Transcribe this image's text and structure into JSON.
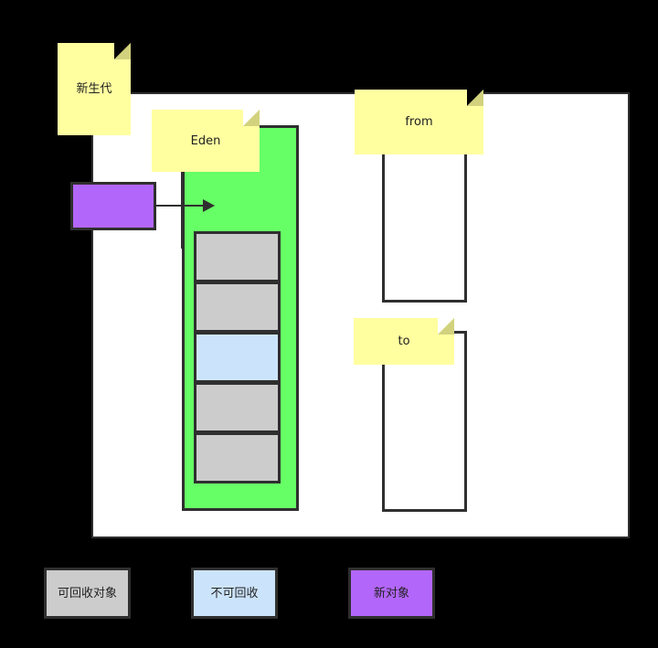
{
  "diagram": {
    "title_note": {
      "label": "新生代"
    },
    "eden": {
      "note_label": "Eden",
      "cells": [
        {
          "kind": "reclaimable"
        },
        {
          "kind": "reclaimable"
        },
        {
          "kind": "non-reclaimable"
        },
        {
          "kind": "reclaimable"
        },
        {
          "kind": "reclaimable"
        }
      ]
    },
    "survivor_from": {
      "note_label": "from"
    },
    "survivor_to": {
      "note_label": "to"
    },
    "new_object": {
      "label": ""
    },
    "arrow": {
      "label": ""
    }
  },
  "legend": {
    "items": [
      {
        "label": "可回收对象",
        "swatch": "#cccccc"
      },
      {
        "label": "不可回收",
        "swatch": "#cce4fb"
      },
      {
        "label": "新对象",
        "swatch": "#b366fa"
      }
    ]
  },
  "colors": {
    "background": "#000000",
    "panel": "#ffffff",
    "eden_green": "#66ff66",
    "note_yellow": "#ffffa0",
    "note_fold": "#d2d27e",
    "stroke": "#2f2f2f",
    "gray_cell": "#cccccc",
    "blue_cell": "#cce4fb",
    "purple": "#b366fa"
  }
}
